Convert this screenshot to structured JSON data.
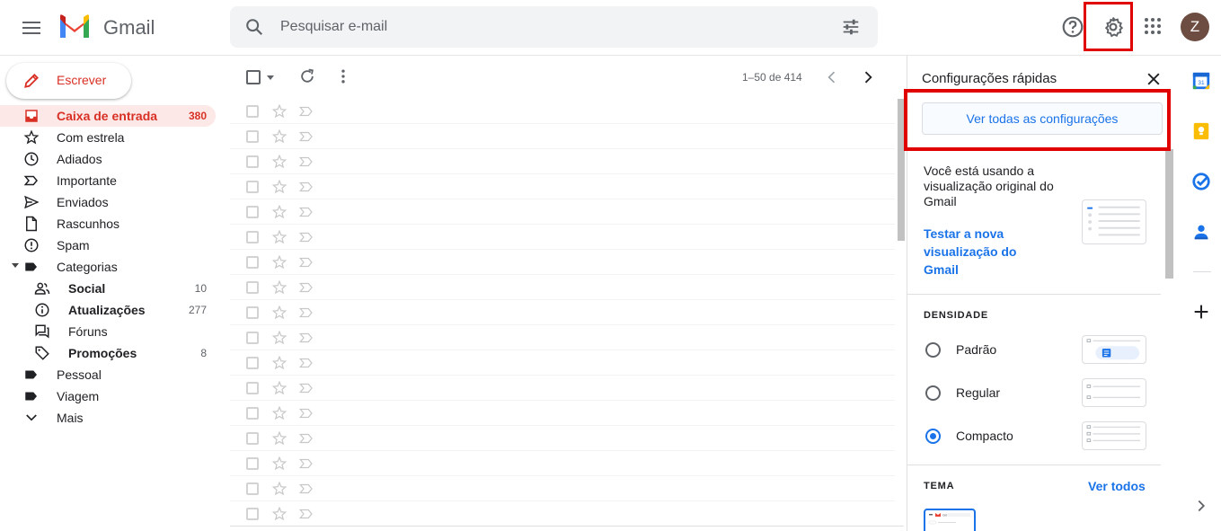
{
  "header": {
    "app_name": "Gmail",
    "search_placeholder": "Pesquisar e-mail",
    "avatar_initial": "Z"
  },
  "compose": {
    "label": "Escrever"
  },
  "nav": {
    "items": [
      {
        "label": "Caixa de entrada",
        "count": "380"
      },
      {
        "label": "Com estrela"
      },
      {
        "label": "Adiados"
      },
      {
        "label": "Importante"
      },
      {
        "label": "Enviados"
      },
      {
        "label": "Rascunhos"
      },
      {
        "label": "Spam"
      },
      {
        "label": "Categorias"
      },
      {
        "label": "Social",
        "count": "10"
      },
      {
        "label": "Atualizações",
        "count": "277"
      },
      {
        "label": "Fóruns"
      },
      {
        "label": "Promoções",
        "count": "8"
      },
      {
        "label": "Pessoal"
      },
      {
        "label": "Viagem"
      },
      {
        "label": "Mais"
      }
    ]
  },
  "toolbar": {
    "range": "1–50 de 414"
  },
  "mail_rows": 17,
  "quick_settings": {
    "title": "Configurações rápidas",
    "all_settings": "Ver todas as configurações",
    "view_text": "Você está usando a visualização original do Gmail",
    "try_new": "Testar a nova visualização do Gmail",
    "density_title": "DENSIDADE",
    "density": [
      {
        "label": "Padrão",
        "selected": false
      },
      {
        "label": "Regular",
        "selected": false
      },
      {
        "label": "Compacto",
        "selected": true
      }
    ],
    "theme_title": "TEMA",
    "theme_all": "Ver todos",
    "theme_thumb_text": "Gmail"
  },
  "colors": {
    "accent_red": "#d93025",
    "highlight_red": "#e00000",
    "link_blue": "#1a73e8"
  }
}
